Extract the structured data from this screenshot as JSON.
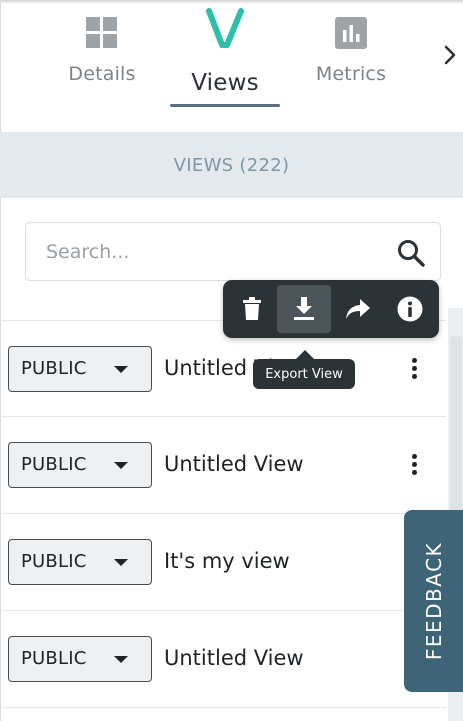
{
  "tabs": {
    "details_label": "Details",
    "views_label": "Views",
    "metrics_label": "Metrics",
    "active": "Views"
  },
  "views_header": {
    "title": "VIEWS (222)"
  },
  "search": {
    "placeholder": "Search...",
    "value": ""
  },
  "toolbar": {
    "delete_icon": "trash-icon",
    "export_icon": "download-icon",
    "share_icon": "share-arrow-icon",
    "info_icon": "info-icon",
    "tooltip": "Export View"
  },
  "views": [
    {
      "visibility": "PUBLIC",
      "name": "Untitled View"
    },
    {
      "visibility": "PUBLIC",
      "name": "Untitled View"
    },
    {
      "visibility": "PUBLIC",
      "name": "It's my view"
    },
    {
      "visibility": "PUBLIC",
      "name": "Untitled View"
    }
  ],
  "feedback": {
    "label": "FEEDBACK"
  },
  "colors": {
    "accent": "#2bc0a8",
    "toolbar_bg": "#2c3336",
    "header_bg": "#e3e9ed",
    "feedback_bg": "#3e6577"
  }
}
